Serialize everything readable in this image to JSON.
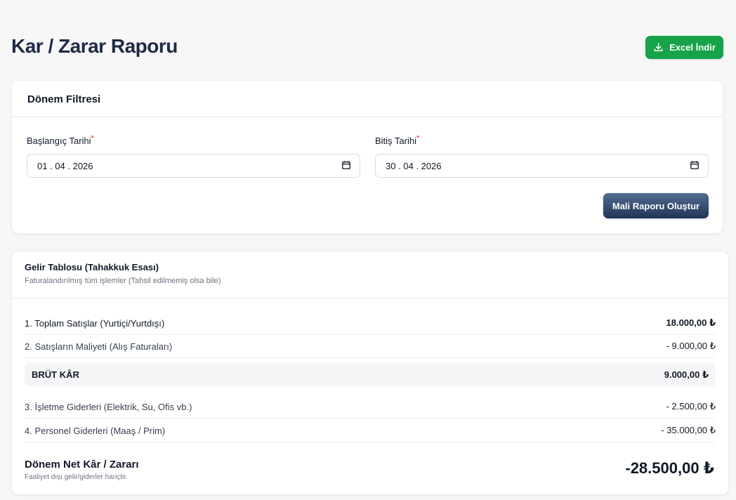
{
  "header": {
    "title": "Kar / Zarar Raporu",
    "excel_button": "Excel İndir"
  },
  "filter": {
    "title": "Dönem Filtresi",
    "start_label": "Başlangıç Tarihi",
    "end_label": "Bitiş Tarihi",
    "required_mark": "*",
    "start_value": "01 . 04 . 2026",
    "end_value": "30 . 04 . 2026",
    "generate_button": "Mali Raporu Oluştur"
  },
  "income": {
    "title": "Gelir Tablosu (Tahakkuk Esası)",
    "subtitle": "Faturalandırılmış tüm işlemler (Tahsil edilmemiş olsa bile)",
    "rows": [
      {
        "label": "1. Toplam Satışlar (Yurtiçi/Yurtdışı)",
        "value": "18.000,00 ₺"
      },
      {
        "label": "2. Satışların Maliyeti (Alış Faturaları)",
        "value": "- 9.000,00 ₺"
      },
      {
        "label": "3. İşletme Giderleri (Elektrik, Su, Ofis vb.)",
        "value": "- 2.500,00 ₺"
      },
      {
        "label": "4. Personel Giderleri (Maaş / Prim)",
        "value": "- 35.000,00 ₺"
      }
    ],
    "gross": {
      "label": "BRÜT KÂR",
      "value": "9.000,00 ₺"
    },
    "net": {
      "label": "Dönem Net Kâr / Zararı",
      "note": "Faaliyet dışı gelir/giderler hariçtir.",
      "value": "-28.500,00 ₺"
    }
  },
  "icons": {
    "excel": "download-icon",
    "date": "calendar-icon"
  },
  "colors": {
    "success": "#16a34a",
    "primary": "#213455",
    "required": "#dc2626"
  }
}
